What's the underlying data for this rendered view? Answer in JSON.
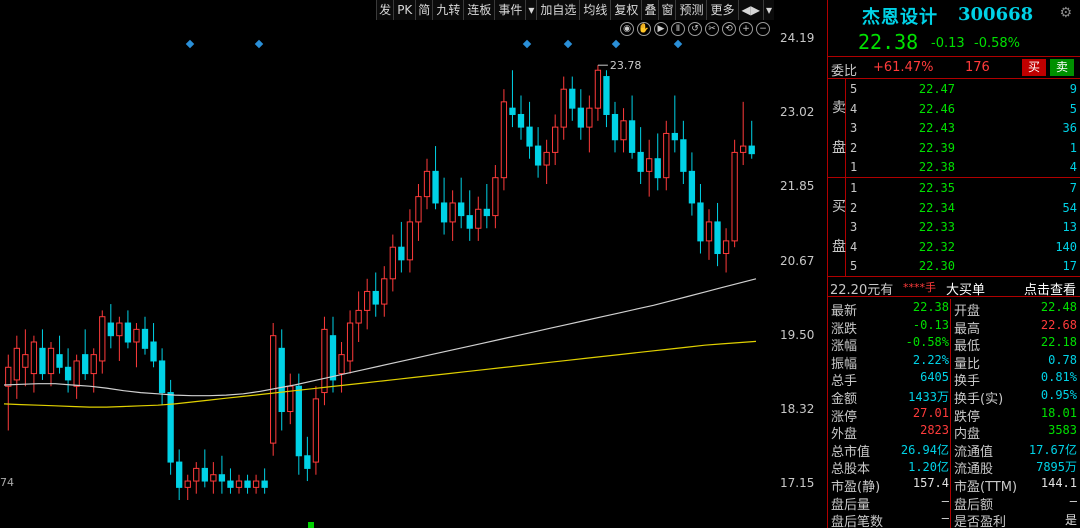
{
  "toolbar": {
    "buttons": [
      "发",
      "PK",
      "简",
      "九转",
      "连板",
      "事件",
      "▾",
      "加自选",
      "均线",
      "复权",
      "叠",
      "窗",
      "预测",
      "更多",
      "◀▶",
      "▾"
    ]
  },
  "chart_tools": [
    "eye-icon",
    "hand-icon",
    "play-icon",
    "pause-icon",
    "undo-icon",
    "scissors-icon",
    "reset-icon",
    "zoom-in-icon",
    "zoom-out-icon"
  ],
  "colors": {
    "up": "#ff3b3b",
    "down": "#00d2e6",
    "ma_white": "#d0d0d0",
    "ma_yellow": "#e0d000",
    "green": "#00e000",
    "cyan": "#00d2e6",
    "frame": "#b00000"
  },
  "chart_data": {
    "type": "candlestick",
    "y_ticks": [
      "24.19",
      "23.02",
      "21.85",
      "20.67",
      "19.50",
      "18.32",
      "17.15"
    ],
    "y_tick_values": [
      24.19,
      23.02,
      21.85,
      20.67,
      19.5,
      18.32,
      17.15
    ],
    "ylim": [
      16.9,
      24.4
    ],
    "max_annotation": "23.78",
    "max_value": 23.78,
    "left_fragment": "74",
    "candles": [
      {
        "o": 18.7,
        "h": 19.2,
        "l": 18.0,
        "c": 19.0
      },
      {
        "o": 18.8,
        "h": 19.5,
        "l": 18.5,
        "c": 19.3
      },
      {
        "o": 19.0,
        "h": 19.6,
        "l": 18.7,
        "c": 19.2
      },
      {
        "o": 18.9,
        "h": 19.5,
        "l": 18.6,
        "c": 19.4
      },
      {
        "o": 19.3,
        "h": 19.6,
        "l": 18.8,
        "c": 18.9
      },
      {
        "o": 18.9,
        "h": 19.4,
        "l": 18.7,
        "c": 19.3
      },
      {
        "o": 19.2,
        "h": 19.5,
        "l": 18.9,
        "c": 19.0
      },
      {
        "o": 19.0,
        "h": 19.3,
        "l": 18.6,
        "c": 18.8
      },
      {
        "o": 18.7,
        "h": 19.2,
        "l": 18.5,
        "c": 19.1
      },
      {
        "o": 19.2,
        "h": 19.6,
        "l": 18.8,
        "c": 18.9
      },
      {
        "o": 18.9,
        "h": 19.3,
        "l": 18.6,
        "c": 19.2
      },
      {
        "o": 19.1,
        "h": 19.9,
        "l": 18.9,
        "c": 19.8
      },
      {
        "o": 19.7,
        "h": 20.0,
        "l": 19.3,
        "c": 19.5
      },
      {
        "o": 19.5,
        "h": 19.8,
        "l": 19.1,
        "c": 19.7
      },
      {
        "o": 19.7,
        "h": 19.9,
        "l": 19.3,
        "c": 19.4
      },
      {
        "o": 19.4,
        "h": 19.7,
        "l": 19.0,
        "c": 19.6
      },
      {
        "o": 19.6,
        "h": 19.8,
        "l": 19.2,
        "c": 19.3
      },
      {
        "o": 19.4,
        "h": 19.7,
        "l": 19.0,
        "c": 19.1
      },
      {
        "o": 19.1,
        "h": 19.3,
        "l": 18.4,
        "c": 18.6
      },
      {
        "o": 18.6,
        "h": 18.8,
        "l": 17.3,
        "c": 17.5
      },
      {
        "o": 17.5,
        "h": 17.7,
        "l": 16.9,
        "c": 17.1
      },
      {
        "o": 17.1,
        "h": 17.3,
        "l": 16.9,
        "c": 17.2
      },
      {
        "o": 17.2,
        "h": 17.5,
        "l": 17.0,
        "c": 17.4
      },
      {
        "o": 17.4,
        "h": 17.7,
        "l": 17.1,
        "c": 17.2
      },
      {
        "o": 17.2,
        "h": 17.5,
        "l": 17.0,
        "c": 17.3
      },
      {
        "o": 17.3,
        "h": 17.6,
        "l": 17.0,
        "c": 17.2
      },
      {
        "o": 17.2,
        "h": 17.4,
        "l": 17.0,
        "c": 17.1
      },
      {
        "o": 17.1,
        "h": 17.3,
        "l": 17.0,
        "c": 17.2
      },
      {
        "o": 17.2,
        "h": 17.3,
        "l": 17.0,
        "c": 17.1
      },
      {
        "o": 17.1,
        "h": 17.3,
        "l": 17.0,
        "c": 17.2
      },
      {
        "o": 17.2,
        "h": 17.4,
        "l": 17.0,
        "c": 17.1
      },
      {
        "o": 17.8,
        "h": 19.7,
        "l": 17.6,
        "c": 19.5
      },
      {
        "o": 19.3,
        "h": 19.6,
        "l": 18.0,
        "c": 18.3
      },
      {
        "o": 18.3,
        "h": 18.9,
        "l": 18.1,
        "c": 18.7
      },
      {
        "o": 18.7,
        "h": 18.9,
        "l": 17.3,
        "c": 17.6
      },
      {
        "o": 17.6,
        "h": 17.9,
        "l": 17.2,
        "c": 17.4
      },
      {
        "o": 17.5,
        "h": 18.7,
        "l": 17.3,
        "c": 18.5
      },
      {
        "o": 18.6,
        "h": 19.8,
        "l": 18.4,
        "c": 19.6
      },
      {
        "o": 19.5,
        "h": 19.8,
        "l": 18.6,
        "c": 18.8
      },
      {
        "o": 18.9,
        "h": 19.4,
        "l": 18.6,
        "c": 19.2
      },
      {
        "o": 19.1,
        "h": 19.9,
        "l": 18.9,
        "c": 19.7
      },
      {
        "o": 19.7,
        "h": 20.2,
        "l": 19.4,
        "c": 19.9
      },
      {
        "o": 19.9,
        "h": 20.4,
        "l": 19.6,
        "c": 20.2
      },
      {
        "o": 20.2,
        "h": 20.5,
        "l": 19.8,
        "c": 20.0
      },
      {
        "o": 20.0,
        "h": 20.6,
        "l": 19.8,
        "c": 20.4
      },
      {
        "o": 20.4,
        "h": 21.1,
        "l": 20.2,
        "c": 20.9
      },
      {
        "o": 20.9,
        "h": 21.3,
        "l": 20.5,
        "c": 20.7
      },
      {
        "o": 20.7,
        "h": 21.5,
        "l": 20.5,
        "c": 21.3
      },
      {
        "o": 21.3,
        "h": 21.9,
        "l": 21.0,
        "c": 21.7
      },
      {
        "o": 21.7,
        "h": 22.3,
        "l": 21.5,
        "c": 22.1
      },
      {
        "o": 22.1,
        "h": 22.5,
        "l": 21.5,
        "c": 21.6
      },
      {
        "o": 21.6,
        "h": 22.0,
        "l": 21.1,
        "c": 21.3
      },
      {
        "o": 21.3,
        "h": 21.8,
        "l": 21.0,
        "c": 21.6
      },
      {
        "o": 21.6,
        "h": 22.0,
        "l": 21.2,
        "c": 21.4
      },
      {
        "o": 21.4,
        "h": 21.8,
        "l": 21.0,
        "c": 21.2
      },
      {
        "o": 21.2,
        "h": 21.7,
        "l": 21.0,
        "c": 21.5
      },
      {
        "o": 21.5,
        "h": 21.9,
        "l": 21.2,
        "c": 21.4
      },
      {
        "o": 21.4,
        "h": 22.2,
        "l": 21.2,
        "c": 22.0
      },
      {
        "o": 22.0,
        "h": 23.4,
        "l": 21.8,
        "c": 23.2
      },
      {
        "o": 23.1,
        "h": 23.7,
        "l": 22.8,
        "c": 23.0
      },
      {
        "o": 23.0,
        "h": 23.3,
        "l": 22.6,
        "c": 22.8
      },
      {
        "o": 22.8,
        "h": 23.2,
        "l": 22.3,
        "c": 22.5
      },
      {
        "o": 22.5,
        "h": 22.8,
        "l": 22.0,
        "c": 22.2
      },
      {
        "o": 22.2,
        "h": 22.6,
        "l": 21.9,
        "c": 22.4
      },
      {
        "o": 22.4,
        "h": 23.0,
        "l": 22.2,
        "c": 22.8
      },
      {
        "o": 22.8,
        "h": 23.6,
        "l": 22.6,
        "c": 23.4
      },
      {
        "o": 23.4,
        "h": 23.6,
        "l": 22.9,
        "c": 23.1
      },
      {
        "o": 23.1,
        "h": 23.4,
        "l": 22.6,
        "c": 22.8
      },
      {
        "o": 22.8,
        "h": 23.3,
        "l": 22.4,
        "c": 23.1
      },
      {
        "o": 23.1,
        "h": 23.78,
        "l": 22.9,
        "c": 23.7
      },
      {
        "o": 23.6,
        "h": 23.7,
        "l": 22.8,
        "c": 23.0
      },
      {
        "o": 23.0,
        "h": 23.2,
        "l": 22.4,
        "c": 22.6
      },
      {
        "o": 22.6,
        "h": 23.1,
        "l": 22.4,
        "c": 22.9
      },
      {
        "o": 22.9,
        "h": 23.3,
        "l": 22.3,
        "c": 22.4
      },
      {
        "o": 22.4,
        "h": 22.8,
        "l": 21.9,
        "c": 22.1
      },
      {
        "o": 22.1,
        "h": 22.6,
        "l": 21.7,
        "c": 22.3
      },
      {
        "o": 22.3,
        "h": 22.7,
        "l": 21.8,
        "c": 22.0
      },
      {
        "o": 22.0,
        "h": 22.9,
        "l": 21.8,
        "c": 22.7
      },
      {
        "o": 22.7,
        "h": 23.3,
        "l": 22.4,
        "c": 22.6
      },
      {
        "o": 22.6,
        "h": 22.9,
        "l": 21.9,
        "c": 22.1
      },
      {
        "o": 22.1,
        "h": 22.4,
        "l": 21.4,
        "c": 21.6
      },
      {
        "o": 21.6,
        "h": 21.9,
        "l": 20.8,
        "c": 21.0
      },
      {
        "o": 21.0,
        "h": 21.5,
        "l": 20.7,
        "c": 21.3
      },
      {
        "o": 21.3,
        "h": 21.6,
        "l": 20.6,
        "c": 20.8
      },
      {
        "o": 20.8,
        "h": 21.2,
        "l": 20.5,
        "c": 21.0
      },
      {
        "o": 21.0,
        "h": 22.6,
        "l": 20.9,
        "c": 22.4
      },
      {
        "o": 22.4,
        "h": 23.2,
        "l": 22.2,
        "c": 22.5
      },
      {
        "o": 22.5,
        "h": 22.9,
        "l": 22.3,
        "c": 22.38
      }
    ],
    "ma_white": [
      18.72,
      18.73,
      18.74,
      18.74,
      18.72,
      18.7,
      18.67,
      18.63,
      18.6,
      18.58,
      18.56,
      18.55,
      18.55,
      18.56,
      18.58,
      18.62,
      18.67,
      18.72,
      18.78,
      18.84,
      18.9,
      18.96,
      19.02,
      19.08,
      19.14,
      19.2,
      19.26,
      19.32,
      19.38,
      19.44,
      19.5,
      19.56,
      19.62,
      19.68,
      19.74,
      19.8,
      19.86,
      19.92,
      19.98,
      20.05,
      20.12,
      20.19,
      20.26,
      20.33,
      20.4
    ],
    "ma_yellow": [
      18.42,
      18.41,
      18.4,
      18.39,
      18.38,
      18.37,
      18.37,
      18.38,
      18.39,
      18.4,
      18.42,
      18.45,
      18.48,
      18.51,
      18.54,
      18.57,
      18.6,
      18.63,
      18.66,
      18.69,
      18.72,
      18.75,
      18.78,
      18.81,
      18.84,
      18.87,
      18.9,
      18.93,
      18.96,
      18.99,
      19.02,
      19.05,
      19.08,
      19.11,
      19.14,
      19.17,
      19.2,
      19.23,
      19.26,
      19.29,
      19.32,
      19.35,
      19.37,
      19.39,
      19.41
    ]
  },
  "stock": {
    "name": "杰恩设计",
    "code": "300668",
    "price": "22.38",
    "change": "-0.13",
    "change_pct": "-0.58%"
  },
  "weibi": {
    "label": "委比",
    "pct": "+61.47%",
    "count": "176",
    "buy_label": "买",
    "sell_label": "卖"
  },
  "sell_side": {
    "chars": [
      "卖",
      "盘"
    ]
  },
  "buy_side": {
    "chars": [
      "买",
      "盘"
    ]
  },
  "asks": [
    {
      "level": "5",
      "price": "22.47",
      "vol": "9"
    },
    {
      "level": "4",
      "price": "22.46",
      "vol": "5"
    },
    {
      "level": "3",
      "price": "22.43",
      "vol": "36"
    },
    {
      "level": "2",
      "price": "22.39",
      "vol": "1"
    },
    {
      "level": "1",
      "price": "22.38",
      "vol": "4"
    }
  ],
  "bids": [
    {
      "level": "1",
      "price": "22.35",
      "vol": "7"
    },
    {
      "level": "2",
      "price": "22.34",
      "vol": "54"
    },
    {
      "level": "3",
      "price": "22.33",
      "vol": "13"
    },
    {
      "level": "4",
      "price": "22.32",
      "vol": "140"
    },
    {
      "level": "5",
      "price": "22.30",
      "vol": "17"
    }
  ],
  "big_order": {
    "price_text": "22.20元有",
    "stars": "****手",
    "label": "大买单",
    "link": "点击查看"
  },
  "stats": [
    {
      "l1": "最新",
      "v1": "22.38",
      "c1": "#00e000",
      "l2": "开盘",
      "v2": "22.48",
      "c2": "#00e000"
    },
    {
      "l1": "涨跌",
      "v1": "-0.13",
      "c1": "#00e000",
      "l2": "最高",
      "v2": "22.68",
      "c2": "#ff3b3b"
    },
    {
      "l1": "涨幅",
      "v1": "-0.58%",
      "c1": "#00e000",
      "l2": "最低",
      "v2": "22.18",
      "c2": "#00e000"
    },
    {
      "l1": "振幅",
      "v1": "2.22%",
      "c1": "#00d2e6",
      "l2": "量比",
      "v2": "0.78",
      "c2": "#00d2e6"
    },
    {
      "l1": "总手",
      "v1": "6405",
      "c1": "#00d2e6",
      "l2": "换手",
      "v2": "0.81%",
      "c2": "#00d2e6"
    },
    {
      "l1": "金额",
      "v1": "1433万",
      "c1": "#00d2e6",
      "l2": "换手(实)",
      "v2": "0.95%",
      "c2": "#00d2e6"
    },
    {
      "l1": "涨停",
      "v1": "27.01",
      "c1": "#ff3b3b",
      "l2": "跌停",
      "v2": "18.01",
      "c2": "#00e000"
    },
    {
      "l1": "外盘",
      "v1": "2823",
      "c1": "#ff3b3b",
      "l2": "内盘",
      "v2": "3583",
      "c2": "#00e000"
    },
    {
      "l1": "总市值",
      "v1": "26.94亿",
      "c1": "#00d2e6",
      "l2": "流通值",
      "v2": "17.67亿",
      "c2": "#00d2e6"
    },
    {
      "l1": "总股本",
      "v1": "1.20亿",
      "c1": "#00d2e6",
      "l2": "流通股",
      "v2": "7895万",
      "c2": "#00d2e6"
    },
    {
      "l1": "市盈(静)",
      "v1": "157.4",
      "c1": "#e0e0e0",
      "l2": "市盈(TTM)",
      "v2": "144.1",
      "c2": "#e0e0e0"
    },
    {
      "l1": "盘后量",
      "v1": "—",
      "c1": "#e0e0e0",
      "l2": "盘后额",
      "v2": "—",
      "c2": "#e0e0e0"
    },
    {
      "l1": "盘后笔数",
      "v1": "—",
      "c1": "#e0e0e0",
      "l2": "是否盈利",
      "v2": "是",
      "c2": "#e0e0e0"
    }
  ]
}
